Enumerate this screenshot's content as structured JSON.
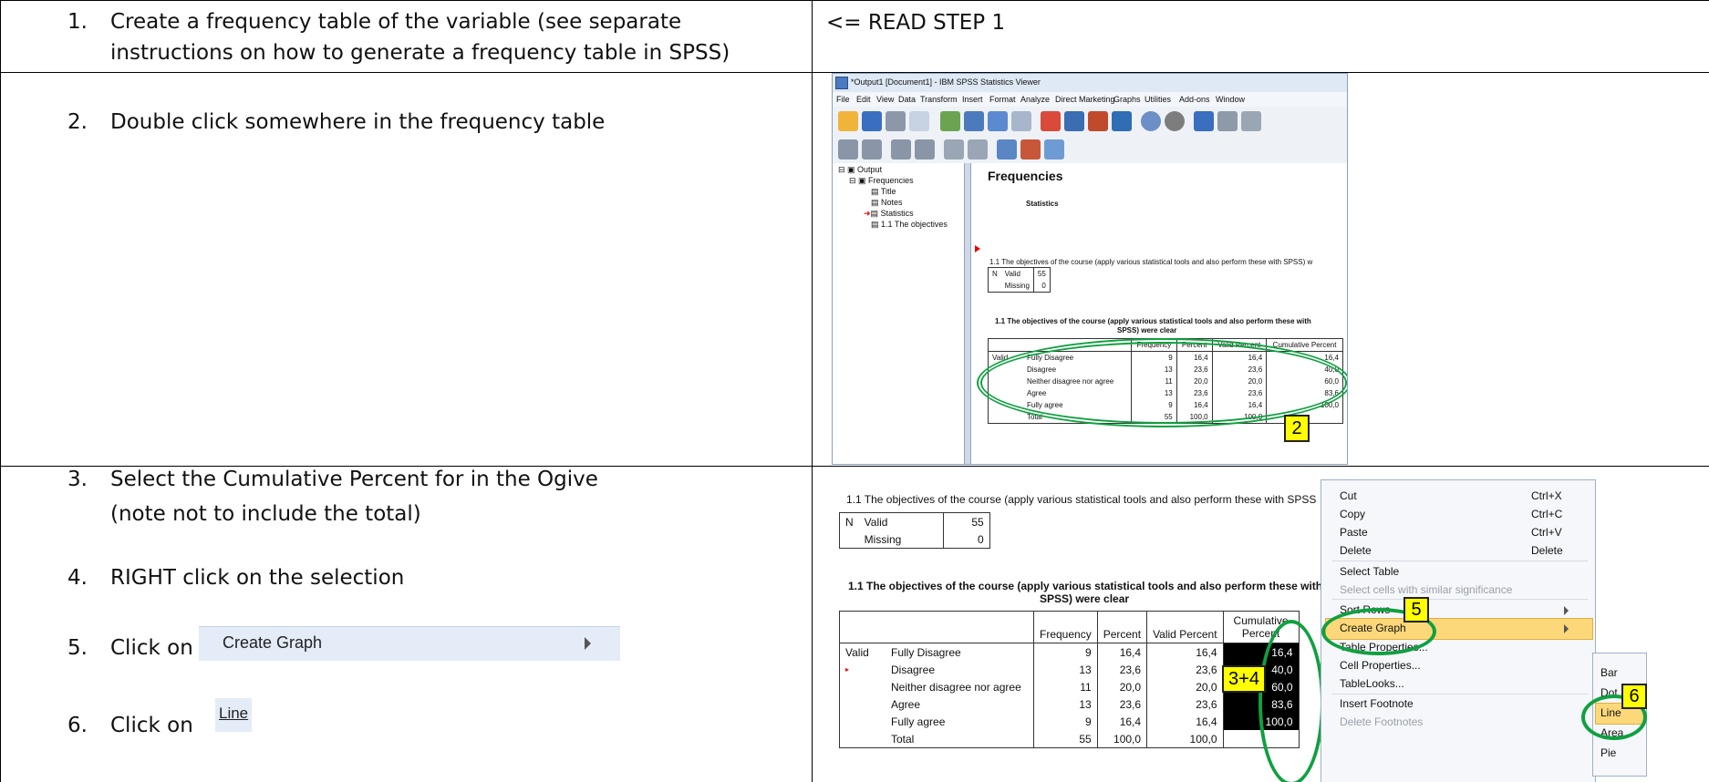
{
  "steps": {
    "s1_num": "1.",
    "s1_line1": "Create a frequency table of the variable (see separate",
    "s1_line2": "instructions on how to generate a frequency table in SPSS)",
    "s2_num": "2.",
    "s2_text": "Double click somewhere in the frequency table",
    "s3_num": "3.",
    "s3_line1": "Select the Cumulative Percent for in the Ogive",
    "s3_line2": "(note not to include the total)",
    "s4_num": "4.",
    "s4_text": "RIGHT click on the selection",
    "s5_num": "5.",
    "s5_text": "Click on",
    "s5_menu": "Create Graph",
    "s6_num": "6.",
    "s6_text": "Click on",
    "s6_menu": "Line"
  },
  "read_step": "<= READ STEP 1",
  "spss": {
    "title": "*Output1 [Document1] - IBM SPSS Statistics Viewer",
    "menu": [
      "File",
      "Edit",
      "View",
      "Data",
      "Transform",
      "Insert",
      "Format",
      "Analyze",
      "Direct Marketing",
      "Graphs",
      "Utilities",
      "Add-ons",
      "Window"
    ],
    "tree": [
      "Output",
      "Frequencies",
      "Title",
      "Notes",
      "Statistics",
      "1.1 The objectives"
    ],
    "heading": "Frequencies",
    "statistics": "Statistics",
    "objectives_line": "1.1 The objectives of the course (apply various statistical tools and also perform these with SPSS) w",
    "n_label": "N",
    "valid": "Valid",
    "missing": "Missing",
    "valid_n": "55",
    "missing_n": "0",
    "table_title1": "1.1 The objectives of the course (apply various statistical tools and also perform these with",
    "table_title2": "SPSS) were clear",
    "cols": [
      "Frequency",
      "Percent",
      "Valid Percent",
      "Cumulative Percent"
    ],
    "rows": [
      {
        "label": "Fully Disagree",
        "f": "9",
        "p": "16,4",
        "vp": "16,4",
        "cp": "16,4"
      },
      {
        "label": "Disagree",
        "f": "13",
        "p": "23,6",
        "vp": "23,6",
        "cp": "40,0"
      },
      {
        "label": "Neither disagree nor agree",
        "f": "11",
        "p": "20,0",
        "vp": "20,0",
        "cp": "60,0"
      },
      {
        "label": "Agree",
        "f": "13",
        "p": "23,6",
        "vp": "23,6",
        "cp": "83,6"
      },
      {
        "label": "Fully agree",
        "f": "9",
        "p": "16,4",
        "vp": "16,4",
        "cp": "100,0"
      },
      {
        "label": "Total",
        "f": "55",
        "p": "100,0",
        "vp": "100,0",
        "cp": ""
      }
    ],
    "badge2": "2"
  },
  "shot2": {
    "objectives_line": "1.1 The objectives of the course (apply various statistical tools and also perform these with SPSS",
    "table_title1": "1.1 The objectives of the course (apply various statistical tools and also perform these with",
    "table_title2": "SPSS) were clear",
    "cumulative": "Cumulative",
    "percent_word": "Percent",
    "badge34": "3+4",
    "badge5": "5",
    "badge6": "6",
    "context_menu": [
      {
        "label": "Cut",
        "shortcut": "Ctrl+X"
      },
      {
        "label": "Copy",
        "shortcut": "Ctrl+C"
      },
      {
        "label": "Paste",
        "shortcut": "Ctrl+V"
      },
      {
        "label": "Delete",
        "shortcut": "Delete"
      },
      {
        "label": "Select Table",
        "shortcut": ""
      },
      {
        "label": "Select cells with similar significance",
        "shortcut": ""
      },
      {
        "label": "Sort Rows",
        "shortcut": ""
      },
      {
        "label": "Create Graph",
        "shortcut": ""
      },
      {
        "label": "Table Properties...",
        "shortcut": ""
      },
      {
        "label": "Cell Properties...",
        "shortcut": ""
      },
      {
        "label": "TableLooks...",
        "shortcut": ""
      },
      {
        "label": "Insert Footnote",
        "shortcut": ""
      },
      {
        "label": "Delete Footnotes",
        "shortcut": ""
      }
    ],
    "submenu": [
      "Bar",
      "Dot",
      "Line",
      "Area",
      "Pie"
    ]
  }
}
